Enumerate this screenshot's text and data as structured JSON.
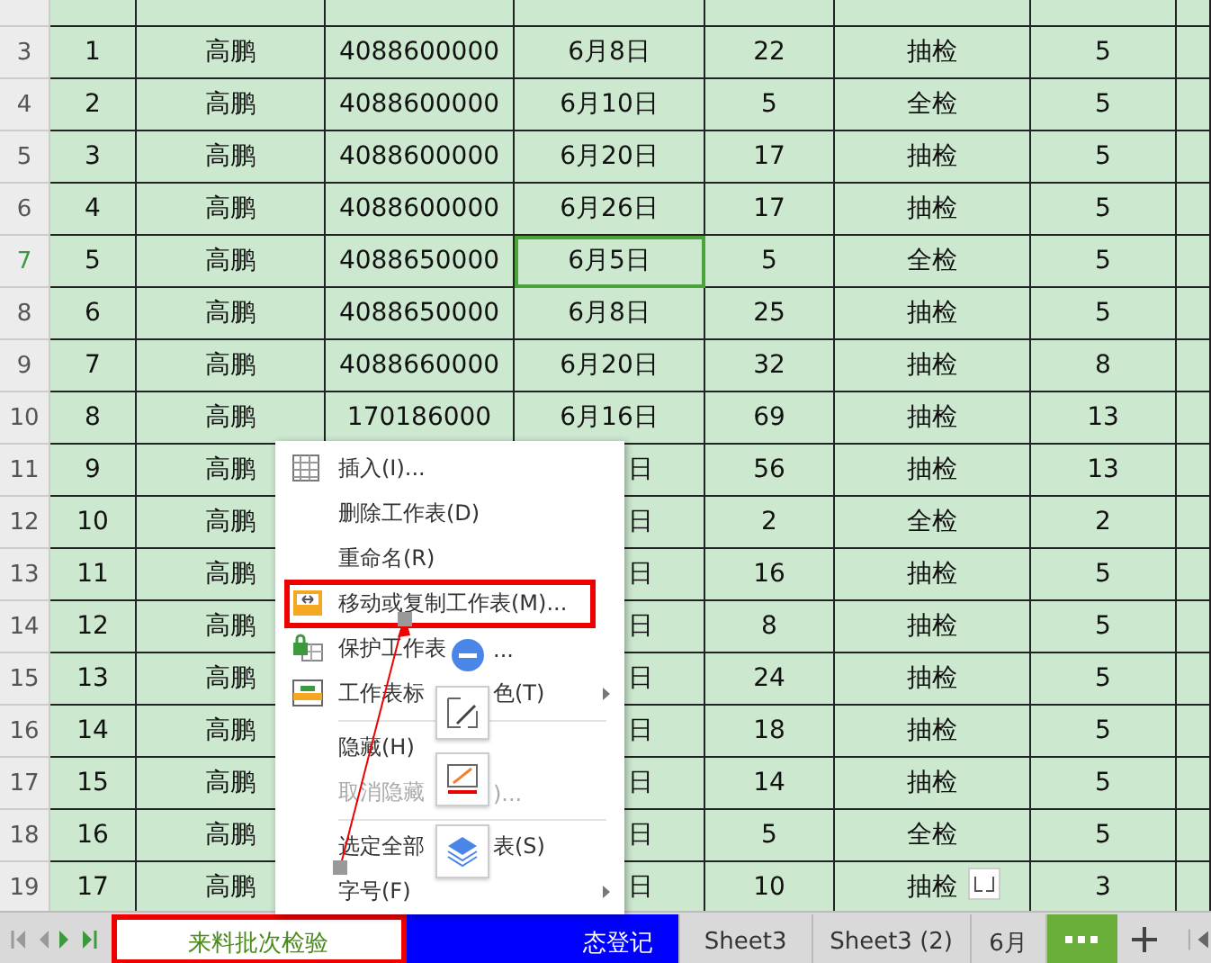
{
  "rows": [
    {
      "number": "3",
      "selected": false,
      "covered": false,
      "cells": [
        "1",
        "高鹏",
        "4088600000",
        "6月8日",
        "22",
        "抽检",
        "5"
      ]
    },
    {
      "number": "4",
      "selected": false,
      "covered": false,
      "cells": [
        "2",
        "高鹏",
        "4088600000",
        "6月10日",
        "5",
        "全检",
        "5"
      ]
    },
    {
      "number": "5",
      "selected": false,
      "covered": false,
      "cells": [
        "3",
        "高鹏",
        "4088600000",
        "6月20日",
        "17",
        "抽检",
        "5"
      ]
    },
    {
      "number": "6",
      "selected": false,
      "covered": false,
      "cells": [
        "4",
        "高鹏",
        "4088600000",
        "6月26日",
        "17",
        "抽检",
        "5"
      ]
    },
    {
      "number": "7",
      "selected": true,
      "covered": false,
      "cells": [
        "5",
        "高鹏",
        "4088650000",
        "6月5日",
        "5",
        "全检",
        "5"
      ]
    },
    {
      "number": "8",
      "selected": false,
      "covered": false,
      "cells": [
        "6",
        "高鹏",
        "4088650000",
        "6月8日",
        "25",
        "抽检",
        "5"
      ]
    },
    {
      "number": "9",
      "selected": false,
      "covered": false,
      "cells": [
        "7",
        "高鹏",
        "4088660000",
        "6月20日",
        "32",
        "抽检",
        "8"
      ]
    },
    {
      "number": "10",
      "selected": false,
      "covered": false,
      "cells": [
        "8",
        "高鹏",
        "170186000",
        "6月16日",
        "69",
        "抽检",
        "13"
      ]
    },
    {
      "number": "11",
      "selected": false,
      "covered": true,
      "cells": [
        "9",
        "高鹏",
        null,
        "日",
        "56",
        "抽检",
        "13"
      ]
    },
    {
      "number": "12",
      "selected": false,
      "covered": true,
      "cells": [
        "10",
        "高鹏",
        null,
        "日",
        "2",
        "全检",
        "2"
      ]
    },
    {
      "number": "13",
      "selected": false,
      "covered": true,
      "cells": [
        "11",
        "高鹏",
        null,
        "日",
        "16",
        "抽检",
        "5"
      ]
    },
    {
      "number": "14",
      "selected": false,
      "covered": true,
      "cells": [
        "12",
        "高鹏",
        null,
        "日",
        "8",
        "抽检",
        "5"
      ]
    },
    {
      "number": "15",
      "selected": false,
      "covered": true,
      "cells": [
        "13",
        "高鹏",
        null,
        "日",
        "24",
        "抽检",
        "5"
      ]
    },
    {
      "number": "16",
      "selected": false,
      "covered": true,
      "cells": [
        "14",
        "高鹏",
        null,
        "日",
        "18",
        "抽检",
        "5"
      ]
    },
    {
      "number": "17",
      "selected": false,
      "covered": true,
      "cells": [
        "15",
        "高鹏",
        null,
        "日",
        "14",
        "抽检",
        "5"
      ]
    },
    {
      "number": "18",
      "selected": false,
      "covered": true,
      "cells": [
        "16",
        "高鹏",
        null,
        "日",
        "5",
        "全检",
        "5"
      ]
    },
    {
      "number": "19",
      "selected": false,
      "covered": true,
      "cells": [
        "17",
        "高鹏",
        null,
        "日",
        "10",
        "抽检",
        "3"
      ]
    }
  ],
  "context_menu": {
    "items": [
      {
        "kind": "item",
        "parts": [
          "插入(I)..."
        ],
        "disabled": false,
        "submenu": false,
        "highlighted": false
      },
      {
        "kind": "item",
        "parts": [
          "删除工作表(D)"
        ],
        "disabled": false,
        "submenu": false,
        "highlighted": false
      },
      {
        "kind": "item",
        "parts": [
          "重命名(R)"
        ],
        "disabled": false,
        "submenu": false,
        "highlighted": false
      },
      {
        "kind": "item",
        "parts": [
          "移动或复制工作表(M)..."
        ],
        "disabled": false,
        "submenu": false,
        "highlighted": true
      },
      {
        "kind": "item",
        "parts": [
          "保护工作表",
          "..."
        ],
        "disabled": false,
        "submenu": false,
        "highlighted": false
      },
      {
        "kind": "item",
        "parts": [
          "工作表标",
          "色(T)"
        ],
        "disabled": false,
        "submenu": true,
        "highlighted": false
      },
      {
        "kind": "separator"
      },
      {
        "kind": "item",
        "parts": [
          "隐藏(H)"
        ],
        "disabled": false,
        "submenu": false,
        "highlighted": false
      },
      {
        "kind": "item",
        "parts": [
          "取消隐藏",
          ")..."
        ],
        "disabled": true,
        "submenu": false,
        "highlighted": false
      },
      {
        "kind": "separator"
      },
      {
        "kind": "item",
        "parts": [
          "选定全部",
          "表(S)"
        ],
        "disabled": false,
        "submenu": false,
        "highlighted": false
      },
      {
        "kind": "item",
        "parts": [
          "字号(F)"
        ],
        "disabled": false,
        "submenu": true,
        "highlighted": false
      }
    ]
  },
  "sheet_tabs": [
    {
      "label": "来料批次检验",
      "selected": true,
      "highlighted": true,
      "color": "#ffffff"
    },
    {
      "label": "态登记",
      "selected": false,
      "highlighted": false,
      "color": "#0000ff"
    },
    {
      "label": "Sheet3",
      "selected": false,
      "highlighted": false,
      "color": "#d9d9d9"
    },
    {
      "label": "Sheet3 (2)",
      "selected": false,
      "highlighted": false,
      "color": "#d9d9d9"
    },
    {
      "label": "6月",
      "selected": false,
      "highlighted": false,
      "color": "#d9d9d9"
    }
  ]
}
